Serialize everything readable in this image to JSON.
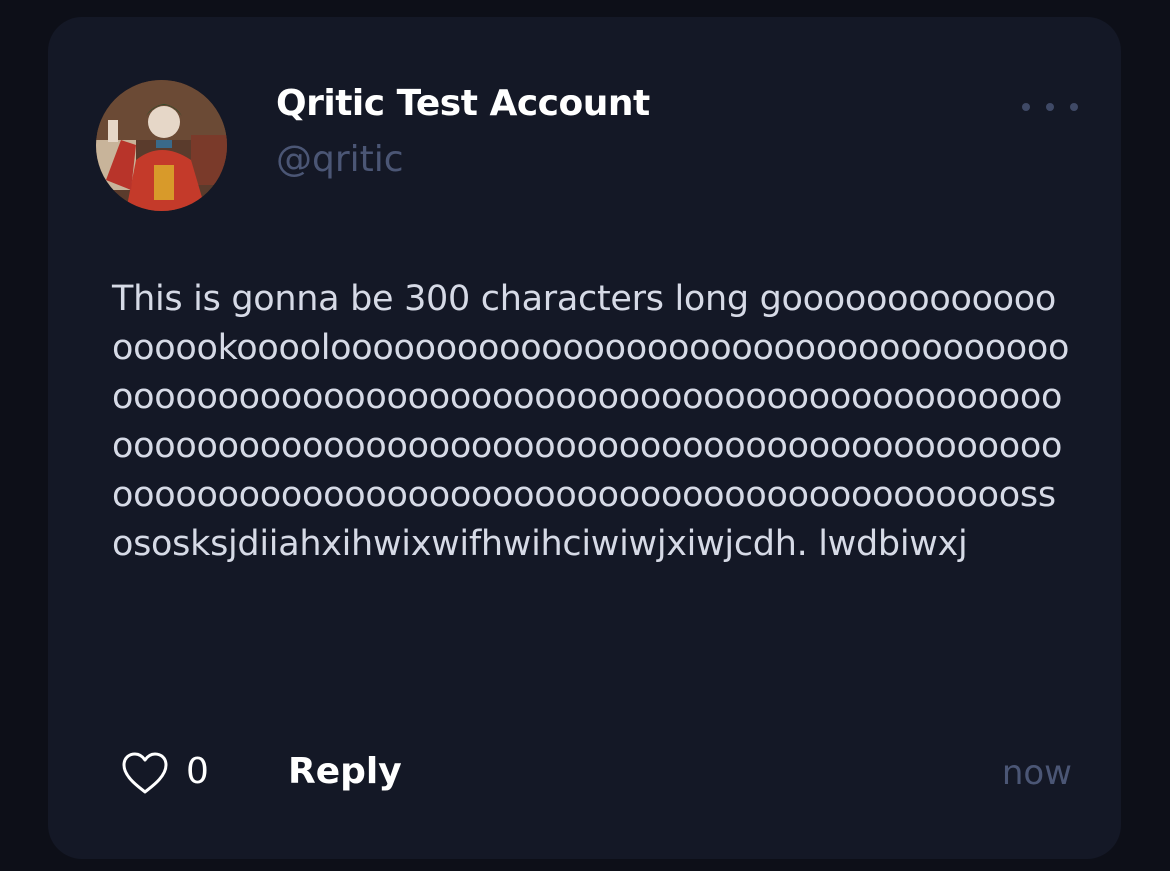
{
  "post": {
    "display_name": "Qritic Test Account",
    "handle": "@qritic",
    "text": "This is gonna be 300 characters long gooooooooooooooooookooooloooooooooooooooooooooooooooooooooooooooooooooooooooooooooooooooooooooooooooooooooooooooooooooooooooooooooooooooooooooooooooooooooooooooooooooooooooooooooooooooooooooooossososksjdiiahxihwixwifhwihciwiwjxiwjcdh. lwdbiwxj",
    "likes": "0",
    "reply_label": "Reply",
    "timestamp": "now"
  },
  "icons": {
    "avatar": "profile-photo",
    "more": "more-horizontal-icon",
    "like": "heart-outline-icon"
  },
  "colors": {
    "background": "#0d0f18",
    "card": "#141826",
    "muted": "#4b5675",
    "text": "#d6dae6"
  }
}
